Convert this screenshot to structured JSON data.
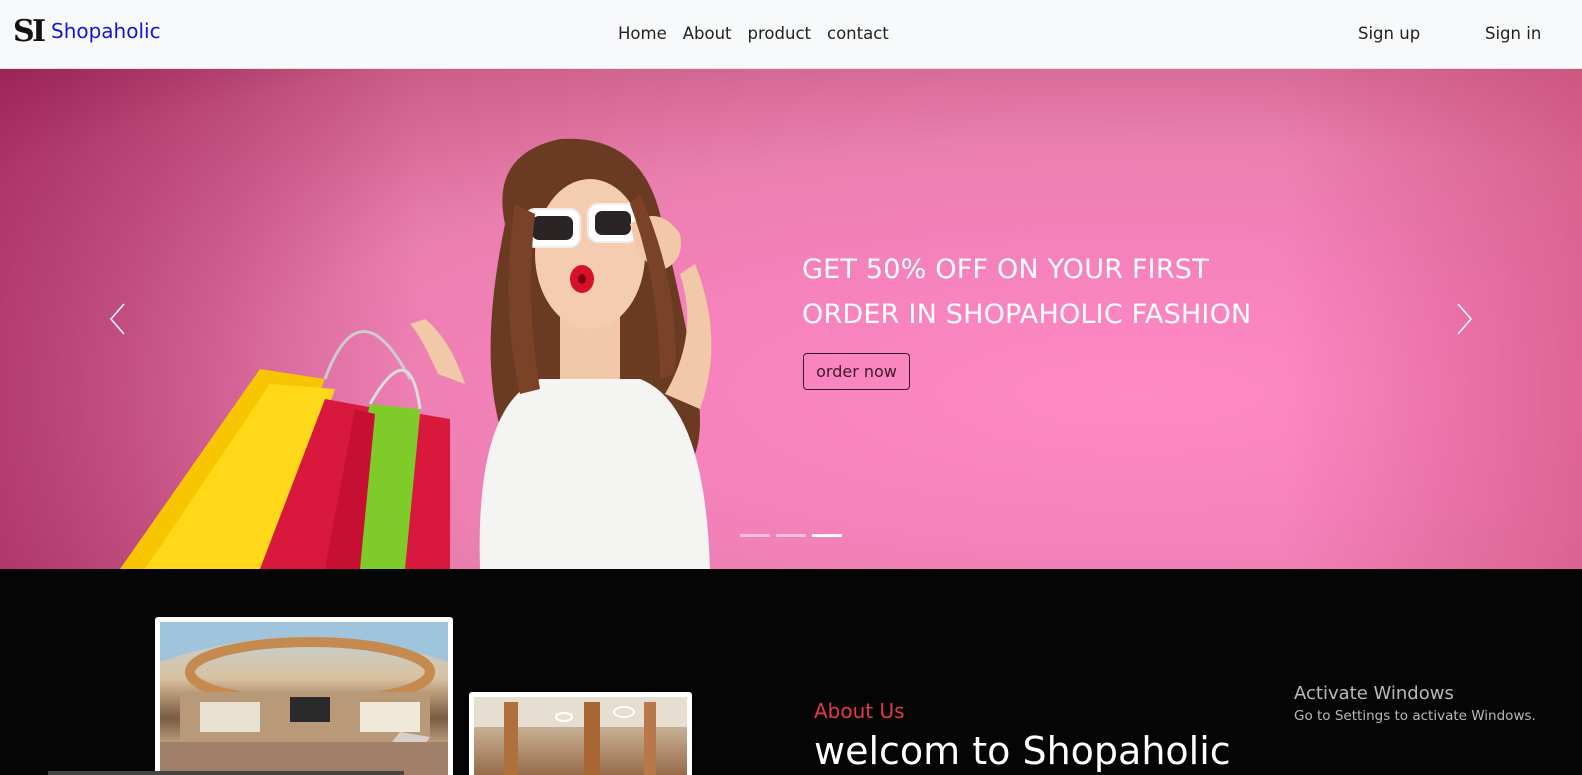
{
  "navbar": {
    "brand_logo_text": "SI",
    "brand_name": "Shopaholic",
    "links": [
      "Home",
      "About",
      "product",
      "contact"
    ],
    "sign_up": "Sign up",
    "sign_in": "Sign in"
  },
  "hero": {
    "headline_line1": "GET 50% OFF ON YOUR FIRST",
    "headline_line2": "ORDER IN SHOPAHOLIC FASHION",
    "cta_label": "order now",
    "slide_count": 3,
    "active_slide": 3
  },
  "about": {
    "label": "About Us",
    "title": "welcom to Shopaholic"
  },
  "watermark": {
    "title": "Activate Windows",
    "subtitle": "Go to Settings to activate Windows."
  },
  "colors": {
    "brand": "#1414d6",
    "accent": "#e23a4a",
    "hero_pink": "#f682bd"
  }
}
